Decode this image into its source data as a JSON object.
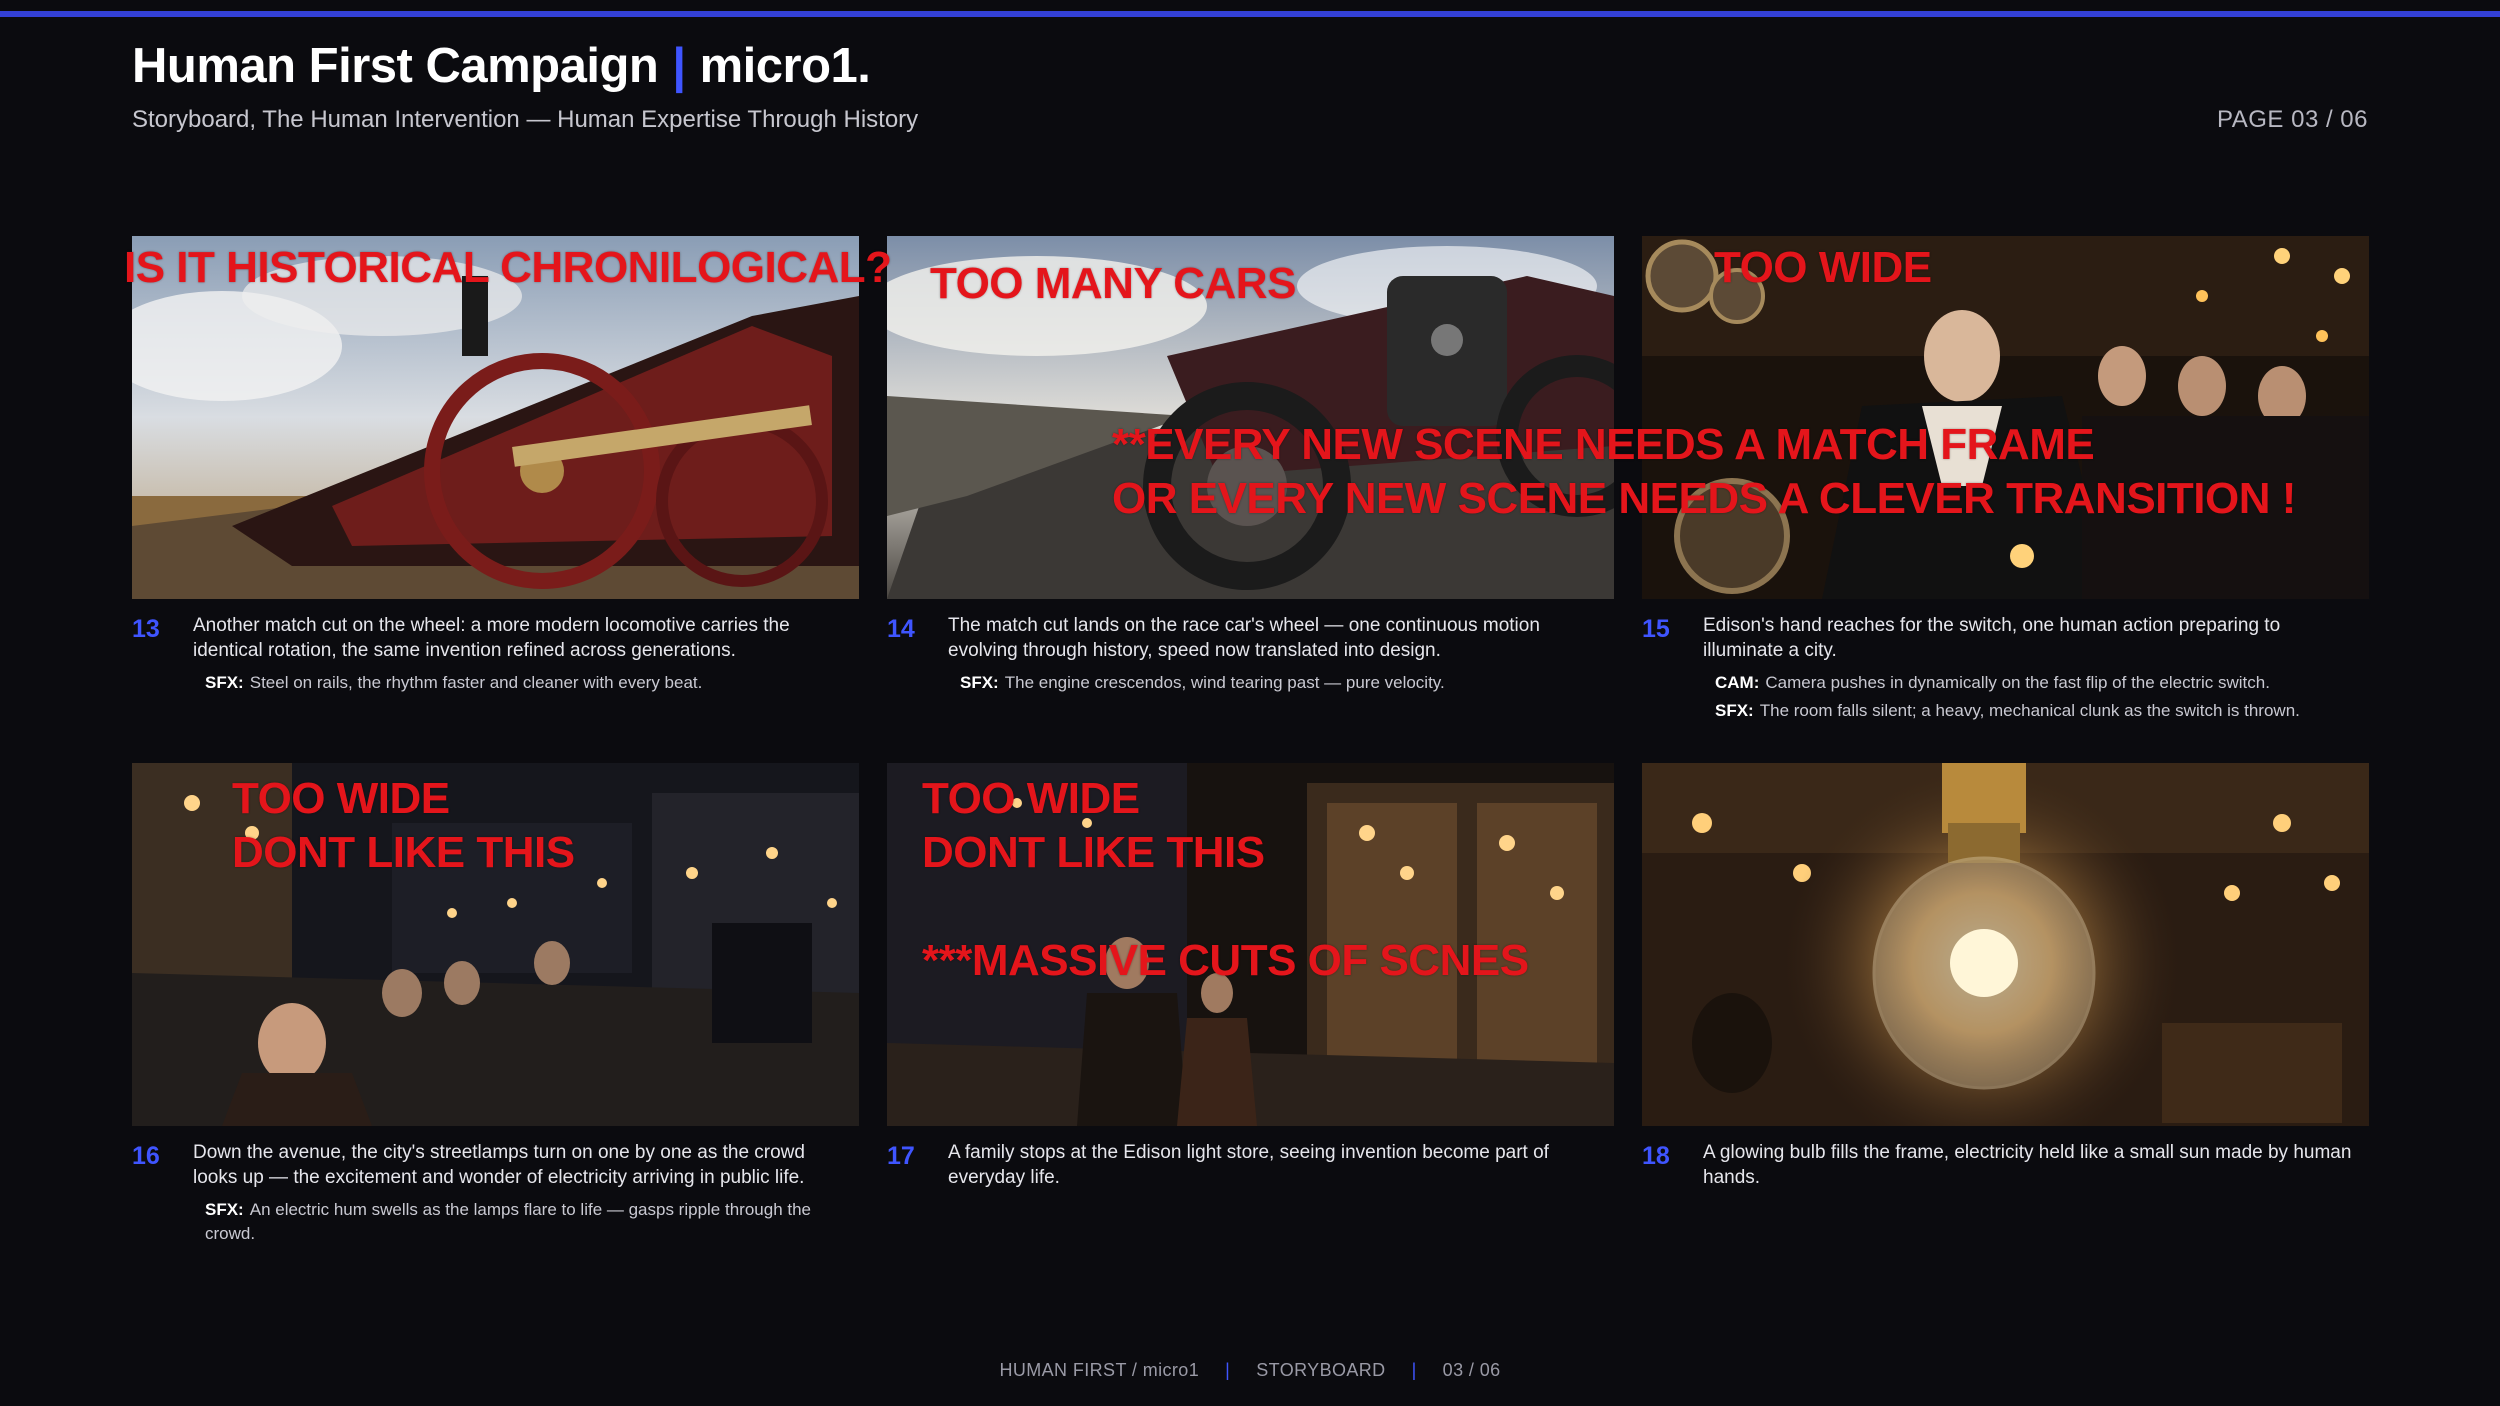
{
  "header": {
    "title": "Human First Campaign",
    "separator": "|",
    "brand": "micro1.",
    "subtitle": "Storyboard, The Human Intervention — Human Expertise Through History",
    "page": "PAGE 03 / 06"
  },
  "colors": {
    "accent": "#3f55ff",
    "annotation": "#e4151b",
    "background": "#0b0b0f"
  },
  "panels": [
    {
      "number": "13",
      "description": "Another match cut on the wheel: a more modern locomotive carries the identical rotation, the same invention refined across generations.",
      "notes": [
        {
          "label": "SFX:",
          "text": "Steel on rails, the rhythm faster and cleaner with every beat."
        }
      ]
    },
    {
      "number": "14",
      "description": "The match cut lands on the race car's wheel — one continuous motion evolving through history, speed now translated into design.",
      "notes": [
        {
          "label": "SFX:",
          "text": "The engine crescendos, wind tearing past — pure velocity."
        }
      ]
    },
    {
      "number": "15",
      "description": "Edison's hand reaches for the switch, one human action preparing to illuminate a city.",
      "notes": [
        {
          "label": "CAM:",
          "text": "Camera pushes in dynamically on the fast flip of the electric switch."
        },
        {
          "label": "SFX:",
          "text": "The room falls silent; a heavy, mechanical clunk as the switch is thrown."
        }
      ]
    },
    {
      "number": "16",
      "description": "Down the avenue, the city's streetlamps turn on one by one as the crowd looks up — the excitement and wonder of electricity arriving in public life.",
      "notes": [
        {
          "label": "SFX:",
          "text": "An electric hum swells as the lamps flare to life — gasps ripple through the crowd."
        }
      ]
    },
    {
      "number": "17",
      "description": "A family stops at the Edison light store, seeing invention become part of everyday life.",
      "notes": []
    },
    {
      "number": "18",
      "description": "A glowing bulb fills the frame, electricity held like a small sun made by human hands.",
      "notes": []
    }
  ],
  "annotations": {
    "a13": "IS IT HISTORICAL CHRONILOGICAL?",
    "a14": "TOO MANY CARS",
    "a15": "TOO WIDE",
    "match_line1": "**EVERY NEW SCENE NEEDS A MATCH FRAME",
    "match_line2": "OR EVERY NEW SCENE NEEDS A CLEVER TRANSITION !",
    "a16_line1": "TOO WIDE",
    "a16_line2": "DONT LIKE THIS",
    "a17_line1": "TOO WIDE",
    "a17_line2": "DONT LIKE THIS",
    "a17_line3": "***MASSIVE CUTS OF SCNES"
  },
  "footer": {
    "brand": "HUMAN FIRST / micro1",
    "section": "STORYBOARD",
    "page": "03 / 06",
    "separator": "|"
  }
}
